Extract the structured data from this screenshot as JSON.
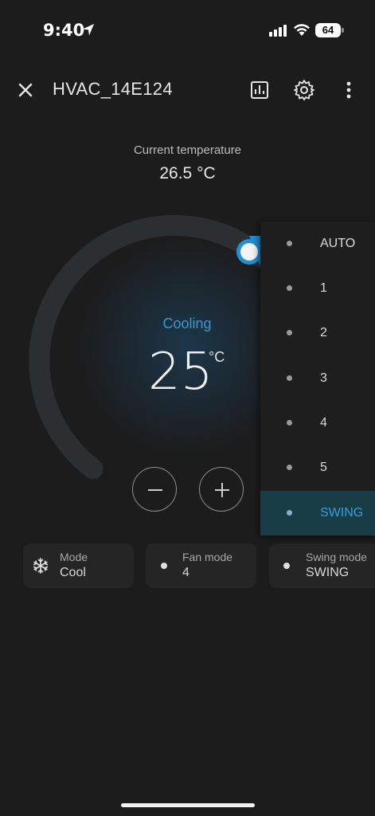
{
  "status_bar": {
    "time": "9:40",
    "battery": "64"
  },
  "header": {
    "title": "HVAC_14E124"
  },
  "current": {
    "label": "Current temperature",
    "value": "26.5 °C"
  },
  "thermostat": {
    "action": "Cooling",
    "target": "25",
    "unit": "°C",
    "accent_color": "#2d9de0"
  },
  "dropdown": {
    "items": [
      {
        "label": "AUTO"
      },
      {
        "label": "1"
      },
      {
        "label": "2"
      },
      {
        "label": "3"
      },
      {
        "label": "4"
      },
      {
        "label": "5"
      },
      {
        "label": "SWING",
        "selected": true
      }
    ]
  },
  "chips": {
    "mode": {
      "label": "Mode",
      "value": "Cool",
      "icon": "snowflake-icon"
    },
    "fan_mode": {
      "label": "Fan mode",
      "value": "4"
    },
    "swing_mode": {
      "label": "Swing mode",
      "value": "SWING"
    }
  }
}
